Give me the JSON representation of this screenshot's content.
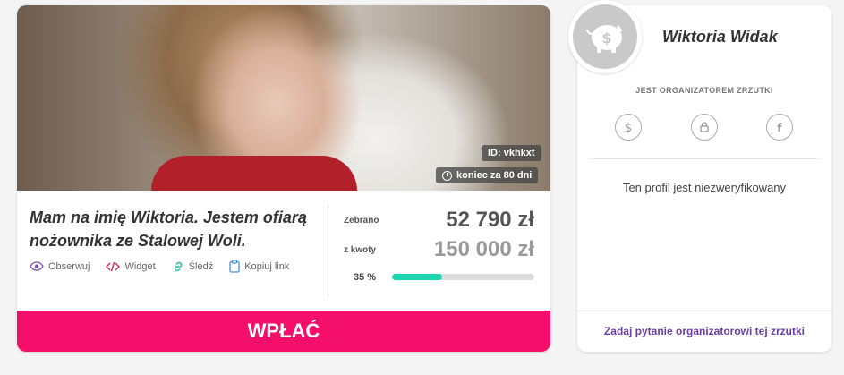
{
  "campaign": {
    "id_badge": "ID: vkhkxt",
    "end_badge": "koniec za 80 dni",
    "title": "Mam na imię Wiktoria. Jestem ofiarą nożownika ze Stalowej Woli.",
    "actions": [
      {
        "label": "Obserwuj",
        "icon": "eye-icon"
      },
      {
        "label": "Widget",
        "icon": "code-icon"
      },
      {
        "label": "Śledź",
        "icon": "link-icon"
      },
      {
        "label": "Kopiuj link",
        "icon": "clipboard-icon"
      }
    ],
    "collected_label": "Zebrano",
    "collected_value": "52 790 zł",
    "goal_label": "z kwoty",
    "goal_value": "150 000 zł",
    "progress_text": "35 %",
    "progress": 0.35,
    "pay_button": "WPŁAĆ"
  },
  "organizer": {
    "name": "Wiktoria Widak",
    "role": "JEST ORGANIZATOREM ZRZUTKI",
    "social_icons": [
      "dollar-icon",
      "lock-icon",
      "facebook-icon"
    ],
    "verification": "Ten profil jest niezweryfikowany",
    "ask_link": "Zadaj pytanie organizatorowi tej zrzutki"
  },
  "colors": {
    "accent_pink": "#f40f6b",
    "progress_teal": "#1ad6b0",
    "link_purple": "#6a3fa0"
  }
}
